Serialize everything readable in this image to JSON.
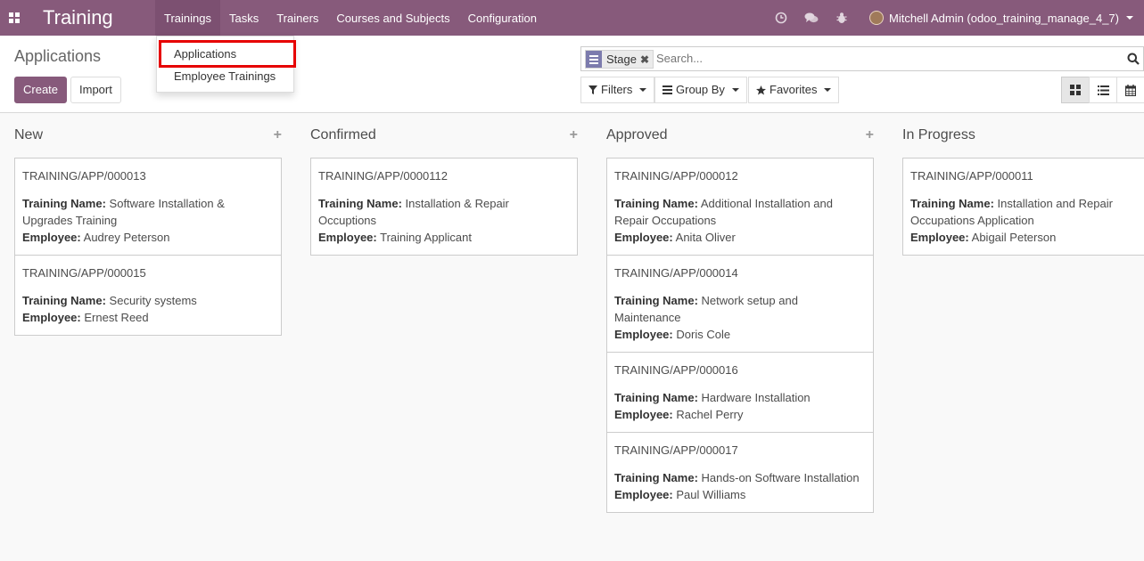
{
  "navbar": {
    "app_title": "Training",
    "menu": [
      "Trainings",
      "Tasks",
      "Trainers",
      "Courses and Subjects",
      "Configuration"
    ],
    "user": "Mitchell Admin (odoo_training_manage_4_7)"
  },
  "dropdown": {
    "items": [
      "Applications",
      "Employee Trainings"
    ]
  },
  "control": {
    "breadcrumb": "Applications",
    "create_label": "Create",
    "import_label": "Import",
    "search_placeholder": "Search...",
    "facet_label": "Stage",
    "filters_label": "Filters",
    "groupby_label": "Group By",
    "favorites_label": "Favorites"
  },
  "labels": {
    "training_name": "Training Name:",
    "employee": "Employee:"
  },
  "columns": [
    {
      "title": "New",
      "cards": [
        {
          "ref": "TRAINING/APP/000013",
          "training": "Software Installation & Upgrades Training",
          "employee": "Audrey Peterson"
        },
        {
          "ref": "TRAINING/APP/000015",
          "training": "Security systems",
          "employee": "Ernest Reed"
        }
      ]
    },
    {
      "title": "Confirmed",
      "cards": [
        {
          "ref": "TRAINING/APP/0000112",
          "training": "Installation & Repair Occuptions",
          "employee": "Training Applicant"
        }
      ]
    },
    {
      "title": "Approved",
      "cards": [
        {
          "ref": "TRAINING/APP/000012",
          "training": "Additional Installation and Repair Occupations",
          "employee": "Anita Oliver"
        },
        {
          "ref": "TRAINING/APP/000014",
          "training": "Network setup and Maintenance",
          "employee": "Doris Cole"
        },
        {
          "ref": "TRAINING/APP/000016",
          "training": "Hardware Installation",
          "employee": "Rachel Perry"
        },
        {
          "ref": "TRAINING/APP/000017",
          "training": "Hands-on Software Installation",
          "employee": "Paul Williams"
        }
      ]
    },
    {
      "title": "In Progress",
      "cards": [
        {
          "ref": "TRAINING/APP/000011",
          "training": "Installation and Repair Occupations Application",
          "employee": "Abigail Peterson"
        }
      ]
    }
  ]
}
